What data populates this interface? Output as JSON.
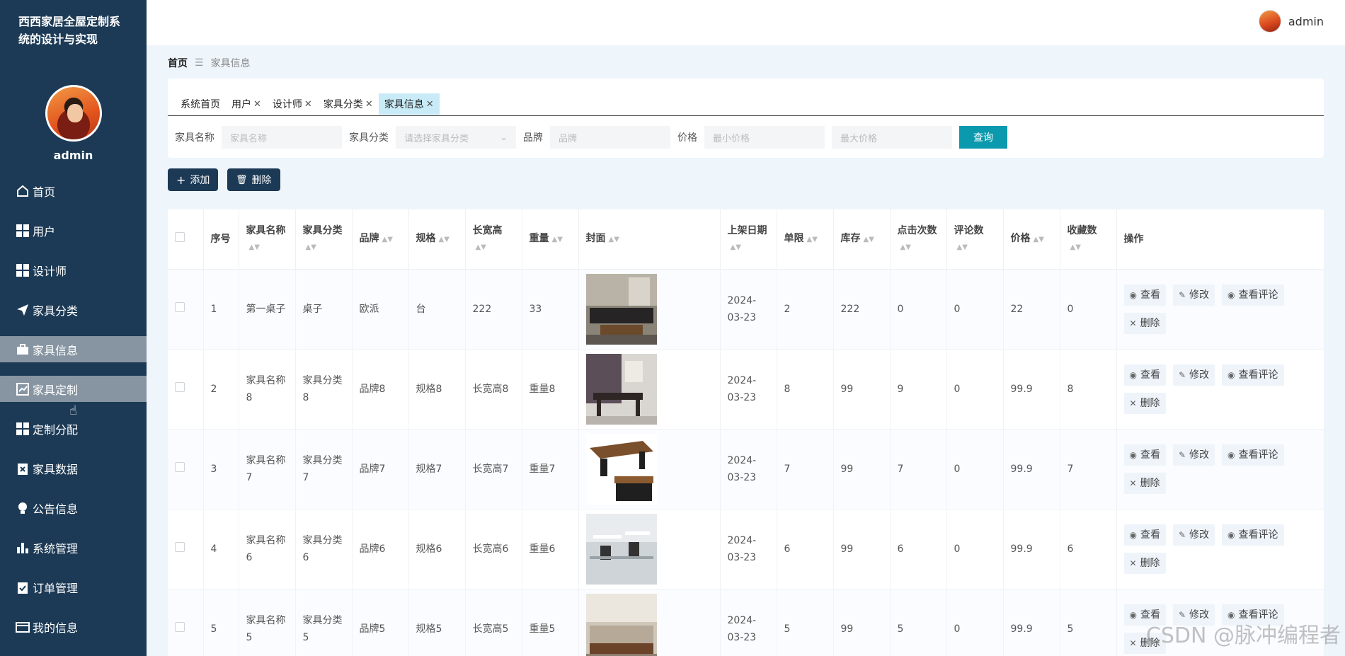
{
  "app": {
    "title": "西西家居全屋定制系统的设计与实现"
  },
  "user": {
    "name": "admin"
  },
  "sidebar": {
    "items": [
      {
        "label": "首页",
        "icon": "home-icon"
      },
      {
        "label": "用户",
        "icon": "grid-icon"
      },
      {
        "label": "设计师",
        "icon": "grid-icon"
      },
      {
        "label": "家具分类",
        "icon": "send-icon"
      },
      {
        "label": "家具信息",
        "icon": "briefcase-icon"
      },
      {
        "label": "家具定制",
        "icon": "chart-icon"
      },
      {
        "label": "定制分配",
        "icon": "grid-icon"
      },
      {
        "label": "家具数据",
        "icon": "clipboard-x-icon"
      },
      {
        "label": "公告信息",
        "icon": "bulb-icon"
      },
      {
        "label": "系统管理",
        "icon": "bar-chart-icon"
      },
      {
        "label": "订单管理",
        "icon": "clipboard-check-icon"
      },
      {
        "label": "我的信息",
        "icon": "card-icon"
      }
    ]
  },
  "breadcrumb": {
    "home": "首页",
    "current": "家具信息"
  },
  "tabs": [
    {
      "label": "系统首页",
      "closable": false
    },
    {
      "label": "用户",
      "closable": true
    },
    {
      "label": "设计师",
      "closable": true
    },
    {
      "label": "家具分类",
      "closable": true
    },
    {
      "label": "家具信息",
      "closable": true
    }
  ],
  "search": {
    "name_label": "家具名称",
    "name_placeholder": "家具名称",
    "category_label": "家具分类",
    "category_placeholder": "请选择家具分类",
    "brand_label": "品牌",
    "brand_placeholder": "品牌",
    "price_label": "价格",
    "min_placeholder": "最小价格",
    "max_placeholder": "最大价格",
    "query_button": "查询"
  },
  "actions": {
    "add": "添加",
    "delete": "删除"
  },
  "table": {
    "headers": [
      "序号",
      "家具名称",
      "家具分类",
      "品牌",
      "规格",
      "长宽高",
      "重量",
      "封面",
      "上架日期",
      "单限",
      "库存",
      "点击次数",
      "评论数",
      "价格",
      "收藏数",
      "操作"
    ],
    "op_labels": {
      "view": "查看",
      "edit": "修改",
      "comments": "查看评论",
      "delete": "删除"
    },
    "rows": [
      {
        "no": "1",
        "name": "第一桌子",
        "category": "桌子",
        "brand": "欧派",
        "spec": "台",
        "size": "222",
        "weight": "33",
        "date": "2024-03-23",
        "limit": "2",
        "stock": "222",
        "clicks": "0",
        "comments": "0",
        "price": "22",
        "favs": "0",
        "cover": "sofa-room"
      },
      {
        "no": "2",
        "name": "家具名称8",
        "category": "家具分类8",
        "brand": "品牌8",
        "spec": "规格8",
        "size": "长宽高8",
        "weight": "重量8",
        "date": "2024-03-23",
        "limit": "8",
        "stock": "99",
        "clicks": "9",
        "comments": "0",
        "price": "99.9",
        "favs": "8",
        "cover": "office-desk"
      },
      {
        "no": "3",
        "name": "家具名称7",
        "category": "家具分类7",
        "brand": "品牌7",
        "spec": "规格7",
        "size": "长宽高7",
        "weight": "重量7",
        "date": "2024-03-23",
        "limit": "7",
        "stock": "99",
        "clicks": "7",
        "comments": "0",
        "price": "99.9",
        "favs": "7",
        "cover": "wood-desk"
      },
      {
        "no": "4",
        "name": "家具名称6",
        "category": "家具分类6",
        "brand": "品牌6",
        "spec": "规格6",
        "size": "长宽高6",
        "weight": "重量6",
        "date": "2024-03-23",
        "limit": "6",
        "stock": "99",
        "clicks": "6",
        "comments": "0",
        "price": "99.9",
        "favs": "6",
        "cover": "workstation"
      },
      {
        "no": "5",
        "name": "家具名称5",
        "category": "家具分类5",
        "brand": "品牌5",
        "spec": "规格5",
        "size": "长宽高5",
        "weight": "重量5",
        "date": "2024-03-23",
        "limit": "5",
        "stock": "99",
        "clicks": "5",
        "comments": "0",
        "price": "99.9",
        "favs": "5",
        "cover": "wood-sofa"
      }
    ]
  },
  "watermark": "CSDN @脉冲编程者"
}
